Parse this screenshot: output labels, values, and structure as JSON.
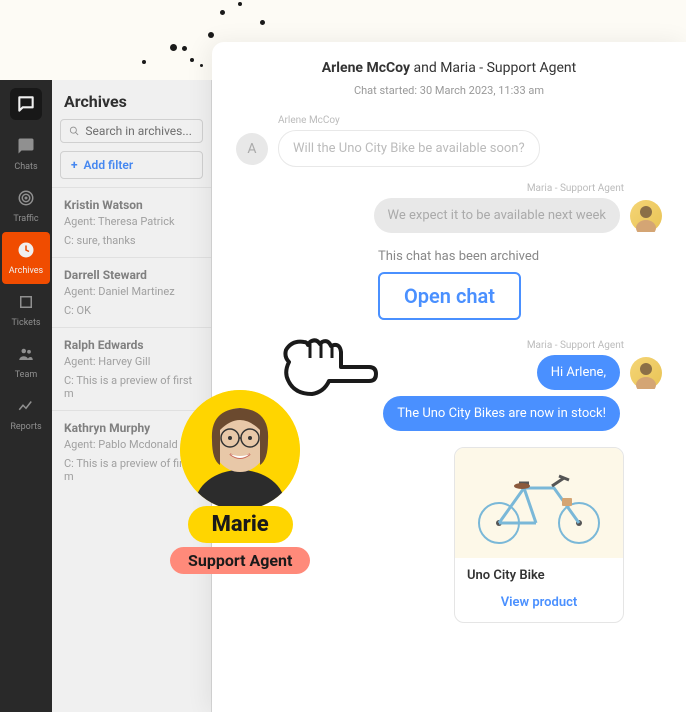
{
  "rail": {
    "items": [
      {
        "name": "chats",
        "label": "Chats"
      },
      {
        "name": "traffic",
        "label": "Traffic"
      },
      {
        "name": "archives",
        "label": "Archives"
      },
      {
        "name": "tickets",
        "label": "Tickets"
      },
      {
        "name": "team",
        "label": "Team"
      },
      {
        "name": "reports",
        "label": "Reports"
      }
    ]
  },
  "archives": {
    "title": "Archives",
    "search_placeholder": "Search in archives...",
    "add_filter_label": "Add filter",
    "items": [
      {
        "name": "Kristin Watson",
        "agent": "Agent: Theresa Patrick",
        "preview": "C: sure, thanks"
      },
      {
        "name": "Darrell Steward",
        "agent": "Agent: Daniel Martinez",
        "preview": "C: OK"
      },
      {
        "name": "Ralph Edwards",
        "agent": "Agent: Harvey Gill",
        "preview": "C: This is a preview of first m"
      },
      {
        "name": "Kathryn Murphy",
        "agent": "Agent: Pablo Mcdonald",
        "preview": "C: This is a preview of first m"
      }
    ]
  },
  "chat": {
    "header_name": "Arlene McCoy",
    "header_rest": " and Maria - Support Agent",
    "started": "Chat started: 30 March 2023, 11:33 am",
    "customer_name": "Arlene McCoy",
    "customer_initial": "A",
    "agent_name": "Maria - Support Agent",
    "msg1": "Will the Uno City Bike be available soon?",
    "msg2": "We expect it to be available next week",
    "archived_text": "This chat has been archived",
    "open_chat_label": "Open chat",
    "msg3": "Hi Arlene,",
    "msg4": "The Uno City Bikes are now in stock!",
    "product": {
      "title": "Uno City Bike",
      "link": "View product"
    }
  },
  "marie": {
    "name": "Marie",
    "role": "Support Agent"
  }
}
